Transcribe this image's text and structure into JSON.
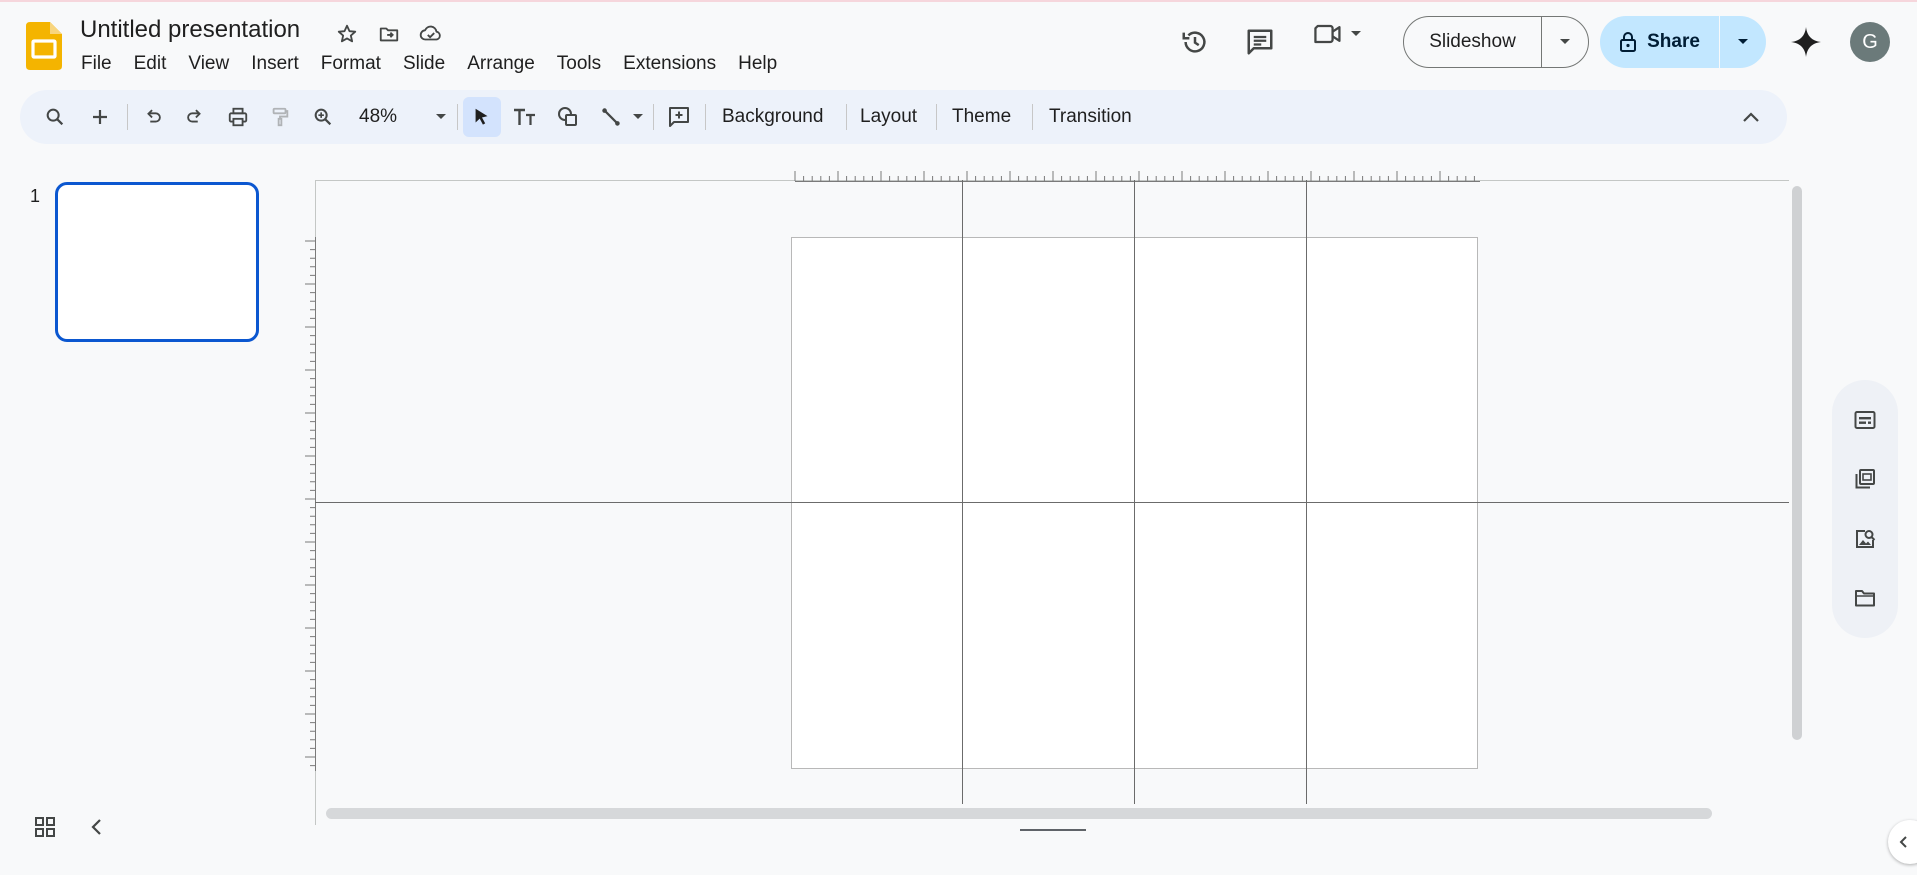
{
  "app": {
    "document_title": "Untitled presentation",
    "menus": [
      "File",
      "Edit",
      "View",
      "Insert",
      "Format",
      "Slide",
      "Arrange",
      "Tools",
      "Extensions",
      "Help"
    ]
  },
  "header": {
    "slideshow_label": "Slideshow",
    "share_label": "Share",
    "avatar_initial": "G"
  },
  "toolbar": {
    "zoom_value": "48%",
    "background_label": "Background",
    "layout_label": "Layout",
    "theme_label": "Theme",
    "transition_label": "Transition"
  },
  "filmstrip": {
    "slides": [
      {
        "number": "1"
      }
    ]
  },
  "icons": {
    "title_bar": [
      "star-icon",
      "move-to-folder-icon",
      "cloud-saved-icon"
    ],
    "header": [
      "version-history-icon",
      "comments-icon",
      "meet-camera-icon",
      "lock-icon",
      "gemini-sparkle-icon"
    ],
    "toolbar": [
      "search-icon",
      "new-slide-icon",
      "undo-icon",
      "redo-icon",
      "print-icon",
      "paint-format-icon",
      "zoom-icon",
      "select-icon",
      "text-box-icon",
      "shape-icon",
      "line-icon",
      "add-comment-icon",
      "collapse-toolbar-icon"
    ],
    "side_panel": [
      "speaker-notes-icon",
      "slides-library-icon",
      "image-search-icon",
      "folder-icon"
    ]
  },
  "colors": {
    "accent_blue": "#0b57d0",
    "share_bg": "#c2e7ff",
    "toolbar_bg": "#edf2fa",
    "logo_yellow": "#f4b400"
  }
}
